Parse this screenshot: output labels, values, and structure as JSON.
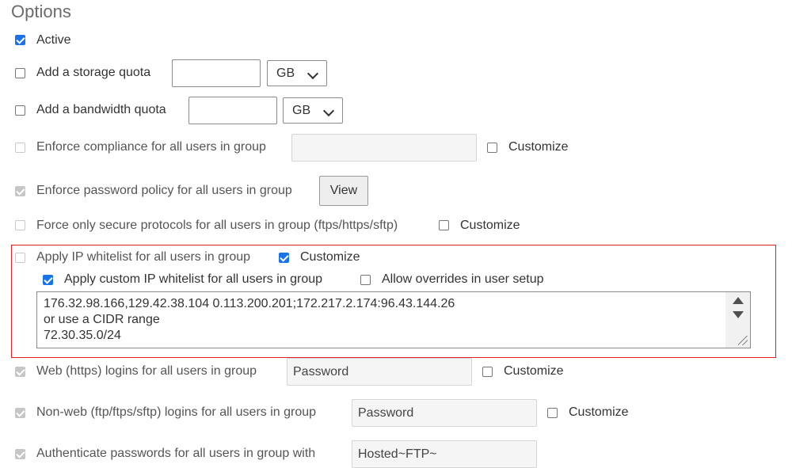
{
  "section": {
    "title": "Options"
  },
  "active": {
    "label": "Active"
  },
  "storage_quota": {
    "label": "Add a storage quota",
    "value": "",
    "unit": "GB"
  },
  "bandwidth_quota": {
    "label": "Add a bandwidth quota",
    "value": "",
    "unit": "GB"
  },
  "compliance": {
    "label": "Enforce compliance for all users in group",
    "value": "",
    "customize_label": "Customize"
  },
  "password_policy": {
    "label": "Enforce password policy for all users in group",
    "view_label": "View"
  },
  "secure_protocols": {
    "label": "Force only secure protocols for all users in group (ftps/https/sftp)",
    "customize_label": "Customize"
  },
  "ip_whitelist": {
    "label": "Apply IP whitelist for all users in group",
    "customize_label": "Customize",
    "custom_label": "Apply custom IP whitelist for all users in group",
    "overrides_label": "Allow overrides in user setup",
    "lines": [
      "176.32.98.166,129.42.38.104 0.113.200.201;172.217.2.174:96.43.144.26",
      "or use a CIDR range",
      "72.30.35.0/24"
    ]
  },
  "web_logins": {
    "label": "Web (https) logins for all users in group",
    "value": "Password",
    "customize_label": "Customize"
  },
  "nonweb_logins": {
    "label": "Non-web (ftp/ftps/sftp) logins for all users in group",
    "value": "Password",
    "customize_label": "Customize"
  },
  "authenticate": {
    "label": "Authenticate passwords for all users in group with",
    "value": "Hosted~FTP~"
  },
  "colors": {
    "checkbox_accent": "#1a73e8",
    "highlight_border": "#e0201f"
  }
}
